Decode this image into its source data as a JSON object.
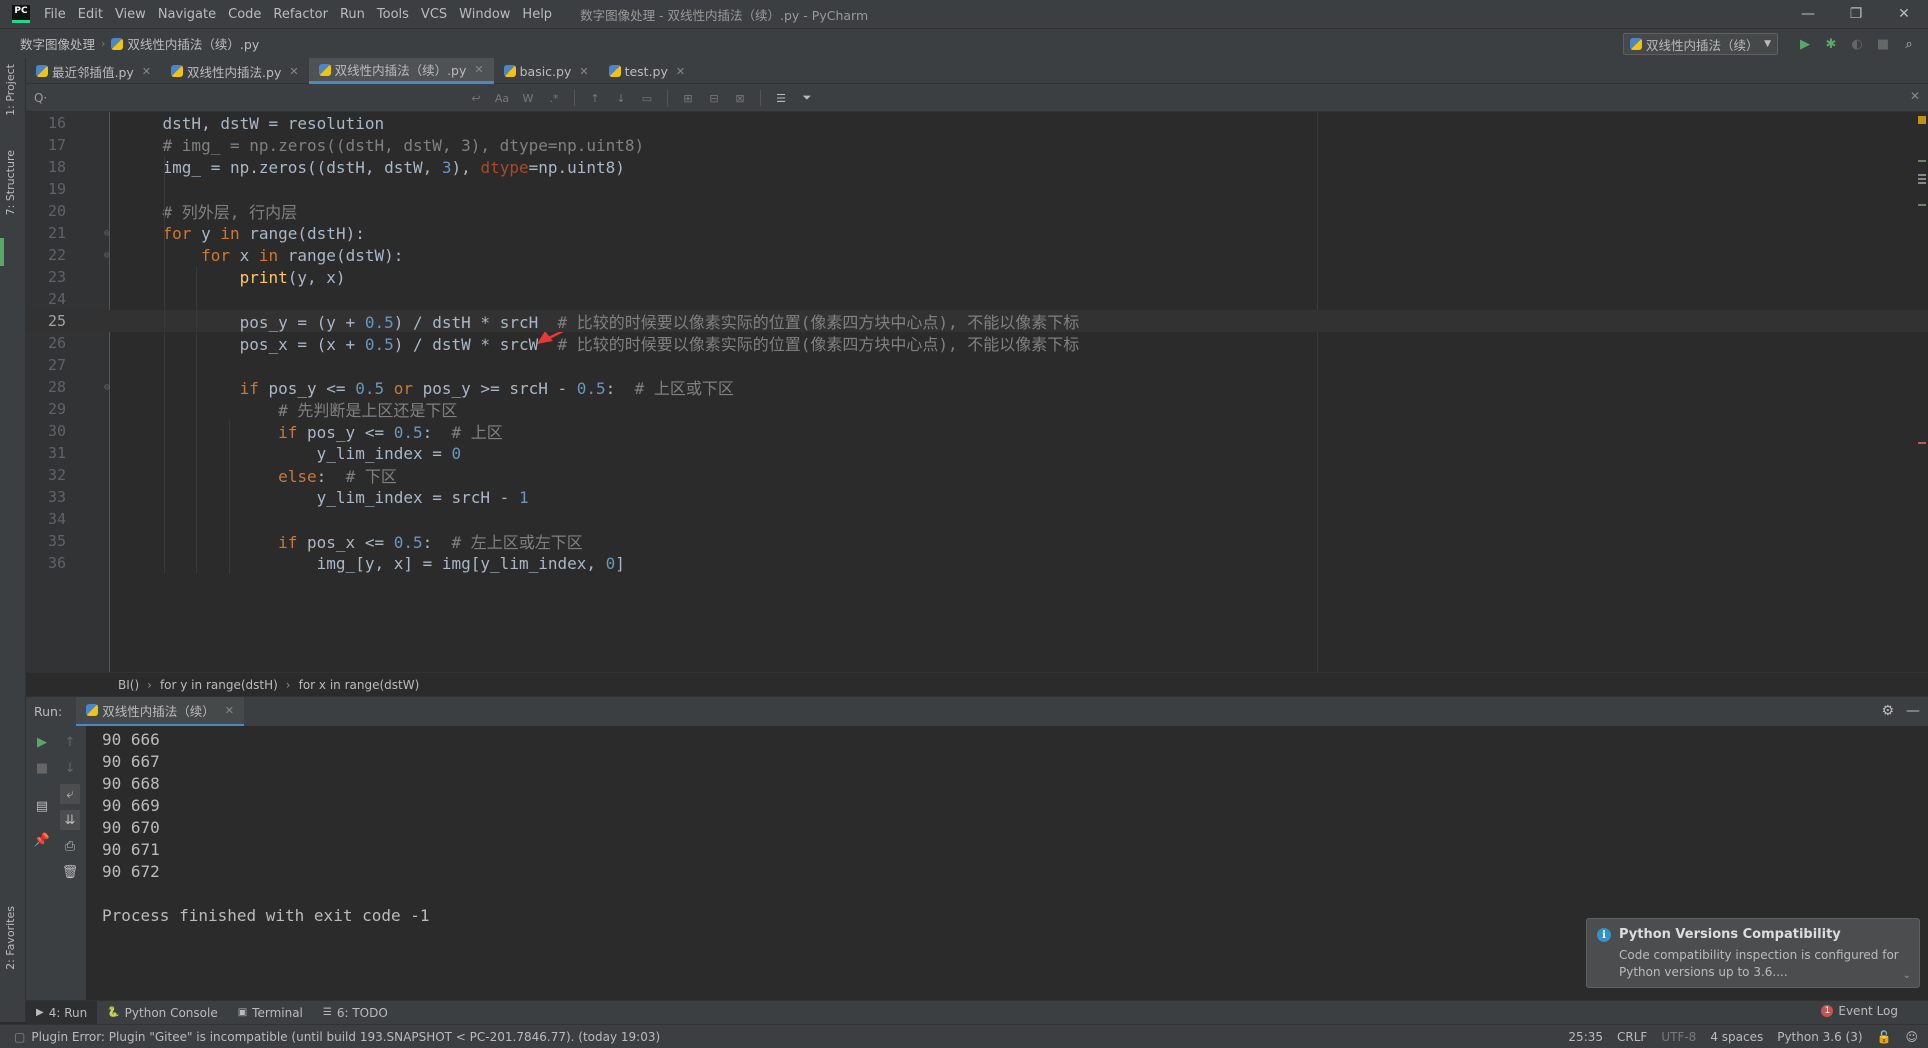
{
  "app": {
    "logo_text": "PC",
    "menu": [
      "File",
      "Edit",
      "View",
      "Navigate",
      "Code",
      "Refactor",
      "Run",
      "Tools",
      "VCS",
      "Window",
      "Help"
    ],
    "window_title": "数字图像处理 - 双线性内插法（续）.py - PyCharm",
    "controls": {
      "minimize": "—",
      "restore": "❐",
      "close": "✕"
    }
  },
  "navbar": {
    "project": "数字图像处理",
    "file": "双线性内插法（续）.py",
    "run_config": "双线性内插法（续）"
  },
  "left_strip": {
    "project": "1: Project",
    "structure": "7: Structure",
    "favorites": "2: Favorites"
  },
  "tabs": [
    {
      "label": "最近邻插值.py",
      "active": false
    },
    {
      "label": "双线性内插法.py",
      "active": false
    },
    {
      "label": "双线性内插法（续）.py",
      "active": true
    },
    {
      "label": "basic.py",
      "active": false
    },
    {
      "label": "test.py",
      "active": false
    }
  ],
  "find": {
    "placeholder": "Q·",
    "aa": "Aa",
    "w": "W",
    "regex": ".*"
  },
  "editor": {
    "current_line": 25,
    "lines": [
      {
        "n": 16,
        "html": "    dstH, dstW = resolution"
      },
      {
        "n": 17,
        "html": "    <span class=\"c-cm\"># img_ = np.zeros((dstH, dstW, 3), dtype=np.uint8)</span>"
      },
      {
        "n": 18,
        "html": "    img_ = np.zeros((dstH, dstW, <span class=\"c-num\">3</span>), <span class=\"c-par\">dtype</span>=np.uint8)"
      },
      {
        "n": 19,
        "html": ""
      },
      {
        "n": 20,
        "html": "    <span class=\"c-cm\"># 列外层, 行内层</span>"
      },
      {
        "n": 21,
        "html": "    <span class=\"c-kw\">for</span> y <span class=\"c-kw\">in</span> range(dstH):"
      },
      {
        "n": 22,
        "html": "        <span class=\"c-kw\">for</span> x <span class=\"c-kw\">in</span> range(dstW):"
      },
      {
        "n": 23,
        "html": "            <span class=\"c-fn\">print</span>(y, x)"
      },
      {
        "n": 24,
        "html": ""
      },
      {
        "n": 25,
        "html": "            pos_y = (y + <span class=\"c-num\">0.5</span>) / dstH * srcH  <span class=\"c-cm\"># 比较的时候要以像素实际的位置(像素四方块中心点), 不能以像素下标</span>"
      },
      {
        "n": 26,
        "html": "            pos_x = (x + <span class=\"c-num\">0.5</span>) / dstW * srcW  <span class=\"c-cm\"># 比较的时候要以像素实际的位置(像素四方块中心点), 不能以像素下标</span>"
      },
      {
        "n": 27,
        "html": ""
      },
      {
        "n": 28,
        "html": "            <span class=\"c-kw\">if</span> pos_y &lt;= <span class=\"c-num\">0.5</span> <span class=\"c-kw\">or</span> pos_y &gt;= srcH - <span class=\"c-num\">0.5</span>:  <span class=\"c-cm\"># 上区或下区</span>"
      },
      {
        "n": 29,
        "html": "                <span class=\"c-cm\"># 先判断是上区还是下区</span>"
      },
      {
        "n": 30,
        "html": "                <span class=\"c-kw\">if</span> pos_y &lt;= <span class=\"c-num\">0.5</span>:  <span class=\"c-cm\"># 上区</span>"
      },
      {
        "n": 31,
        "html": "                    y_lim_index = <span class=\"c-num\">0</span>"
      },
      {
        "n": 32,
        "html": "                <span class=\"c-kw\">else</span>:  <span class=\"c-cm\"># 下区</span>"
      },
      {
        "n": 33,
        "html": "                    y_lim_index = srcH - <span class=\"c-num\">1</span>"
      },
      {
        "n": 34,
        "html": ""
      },
      {
        "n": 35,
        "html": "                <span class=\"c-kw\">if</span> pos_x &lt;= <span class=\"c-num\">0.5</span>:  <span class=\"c-cm\"># 左上区或左下区</span>"
      },
      {
        "n": 36,
        "html": "                    img_[y, x] = img[y_lim_index, <span class=\"c-num\">0</span>]"
      }
    ]
  },
  "editor_breadcrumbs": [
    "BI()",
    "for y in range(dstH)",
    "for x in range(dstW)"
  ],
  "run": {
    "title": "Run:",
    "tab": "双线性内插法（续）",
    "output": [
      "90 666",
      "90 667",
      "90 668",
      "90 669",
      "90 670",
      "90 671",
      "90 672",
      "",
      "Process finished with exit code -1"
    ]
  },
  "notification": {
    "title": "Python Versions Compatibility",
    "body": "Code compatibility inspection is configured for Python versions up to 3.6...."
  },
  "toolwindows": [
    {
      "label": "4: Run",
      "icon": "▶",
      "active": true
    },
    {
      "label": "Python Console",
      "icon": "🐍",
      "active": false
    },
    {
      "label": "Terminal",
      "icon": "▣",
      "active": false
    },
    {
      "label": "6: TODO",
      "icon": "☰",
      "active": false
    }
  ],
  "event_log": {
    "count": "1",
    "label": "Event Log"
  },
  "status": {
    "message": "Plugin Error: Plugin \"Gitee\" is incompatible (until build 193.SNAPSHOT < PC-201.7846.77). (today 19:03)",
    "position": "25:35",
    "line_sep": "CRLF",
    "encoding": "UTF-8",
    "indent": "4 spaces",
    "interpreter": "Python 3.6 (3)"
  },
  "colors": {
    "accent": "#4a88c7",
    "bg": "#2b2b2b",
    "panel": "#3c3f41",
    "keyword": "#cc7832",
    "number": "#6897bb",
    "comment": "#808080"
  }
}
